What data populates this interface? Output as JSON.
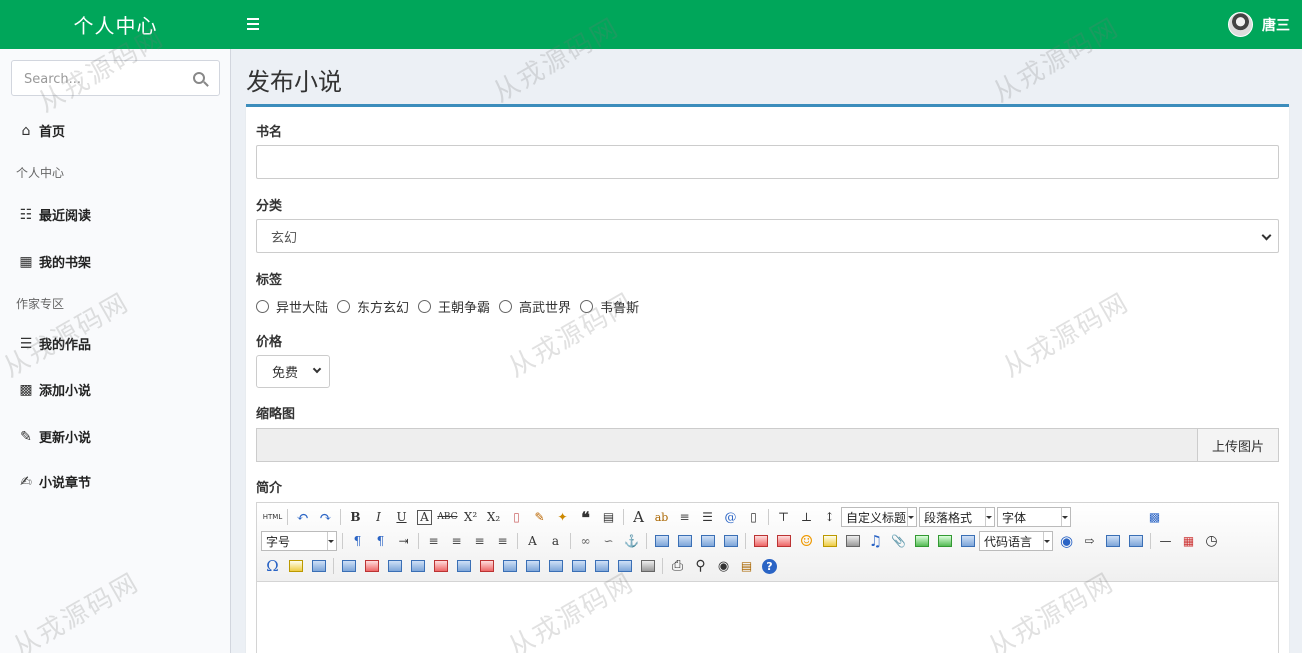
{
  "header": {
    "brand": "个人中心",
    "user_name": "唐三"
  },
  "sidebar": {
    "search_placeholder": "Search...",
    "home": "首页",
    "section_personal": "个人中心",
    "recent_reading": "最近阅读",
    "my_bookshelf": "我的书架",
    "section_author": "作家专区",
    "my_works": "我的作品",
    "add_novel": "添加小说",
    "update_novel": "更新小说",
    "novel_chapters": "小说章节"
  },
  "page": {
    "title": "发布小说"
  },
  "form": {
    "book_name_label": "书名",
    "book_name_value": "",
    "category_label": "分类",
    "category_value": "玄幻",
    "tags_label": "标签",
    "tags": [
      "异世大陆",
      "东方玄幻",
      "王朝争霸",
      "高武世界",
      "韦鲁斯"
    ],
    "price_label": "价格",
    "price_value": "免费",
    "thumbnail_label": "缩略图",
    "upload_button": "上传图片",
    "intro_label": "简介"
  },
  "editor": {
    "custom_title": "自定义标题",
    "paragraph_format": "段落格式",
    "font_family": "字体",
    "font_size": "字号",
    "code_language": "代码语言",
    "html_button": "HTML"
  },
  "watermark": "从戎源码网"
}
